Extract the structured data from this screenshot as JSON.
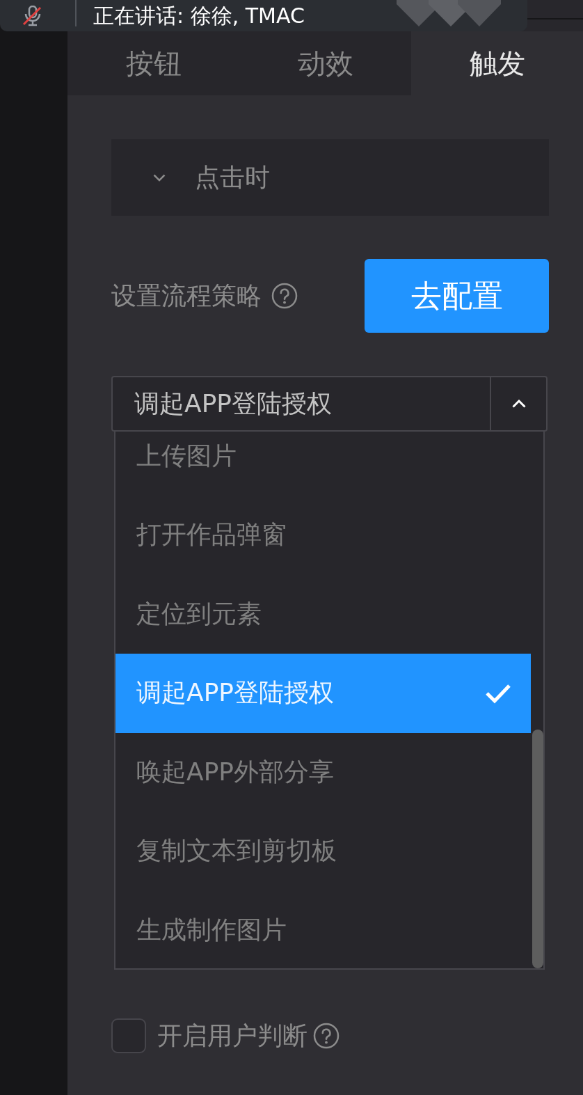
{
  "notification": {
    "text": "正在讲话: 徐徐, TMAC"
  },
  "tabs": [
    {
      "label": "按钮",
      "selected": false
    },
    {
      "label": "动效",
      "selected": false
    },
    {
      "label": "触发",
      "selected": true
    }
  ],
  "trigger": {
    "title": "点击时"
  },
  "strategy": {
    "label": "设置流程策略",
    "button": "去配置"
  },
  "action_select": {
    "value": "调起APP登陆授权",
    "expanded": true,
    "options": [
      {
        "label": "上传图片",
        "selected": false
      },
      {
        "label": "打开作品弹窗",
        "selected": false
      },
      {
        "label": "定位到元素",
        "selected": false
      },
      {
        "label": "调起APP登陆授权",
        "selected": true
      },
      {
        "label": "唤起APP外部分享",
        "selected": false
      },
      {
        "label": "复制文本到剪切板",
        "selected": false
      },
      {
        "label": "生成制作图片",
        "selected": false
      }
    ]
  },
  "user_judgement": {
    "label": "开启用户判断",
    "checked": false
  }
}
